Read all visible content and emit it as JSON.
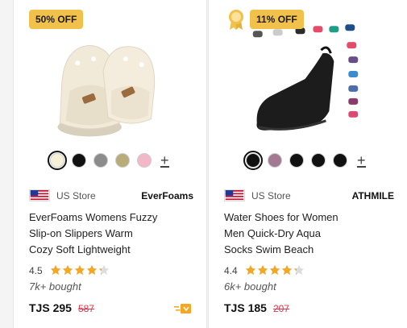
{
  "products": [
    {
      "badge": "50% OFF",
      "store_label": "US Store",
      "brand": "EverFoams",
      "title_lines": [
        "EverFoams Womens Fuzzy",
        "Slip-on Slippers Warm",
        "Cozy Soft Lightweight"
      ],
      "rating": "4.5",
      "bought": "7k+ bought",
      "price": "TJS 295",
      "old_price": "587",
      "swatch_colors": [
        "#f6f1d6",
        "#111111",
        "#8c8c8c",
        "#b8ad78",
        "#f3b8c8"
      ],
      "selected_swatch": 0,
      "plus": "+"
    },
    {
      "badge": "11% OFF",
      "store_label": "US Store",
      "brand": "ATHMILE",
      "title_lines": [
        "Water Shoes for Women",
        "Men Quick-Dry Aqua",
        "Socks Swim Beach"
      ],
      "rating": "4.4",
      "bought": "6k+ bought",
      "price": "TJS 185",
      "old_price": "207",
      "swatch_colors": [
        "#111111",
        "#a47a92",
        "#111111",
        "#111111",
        "#111111"
      ],
      "selected_swatch": 0,
      "plus": "+"
    }
  ],
  "colors": {
    "badge": "#f2c14b",
    "old_price": "#d9364b",
    "star": "#f5a623"
  },
  "icons": [
    "medal-icon",
    "express-delivery-icon",
    "us-flag-icon",
    "star-icon"
  ]
}
